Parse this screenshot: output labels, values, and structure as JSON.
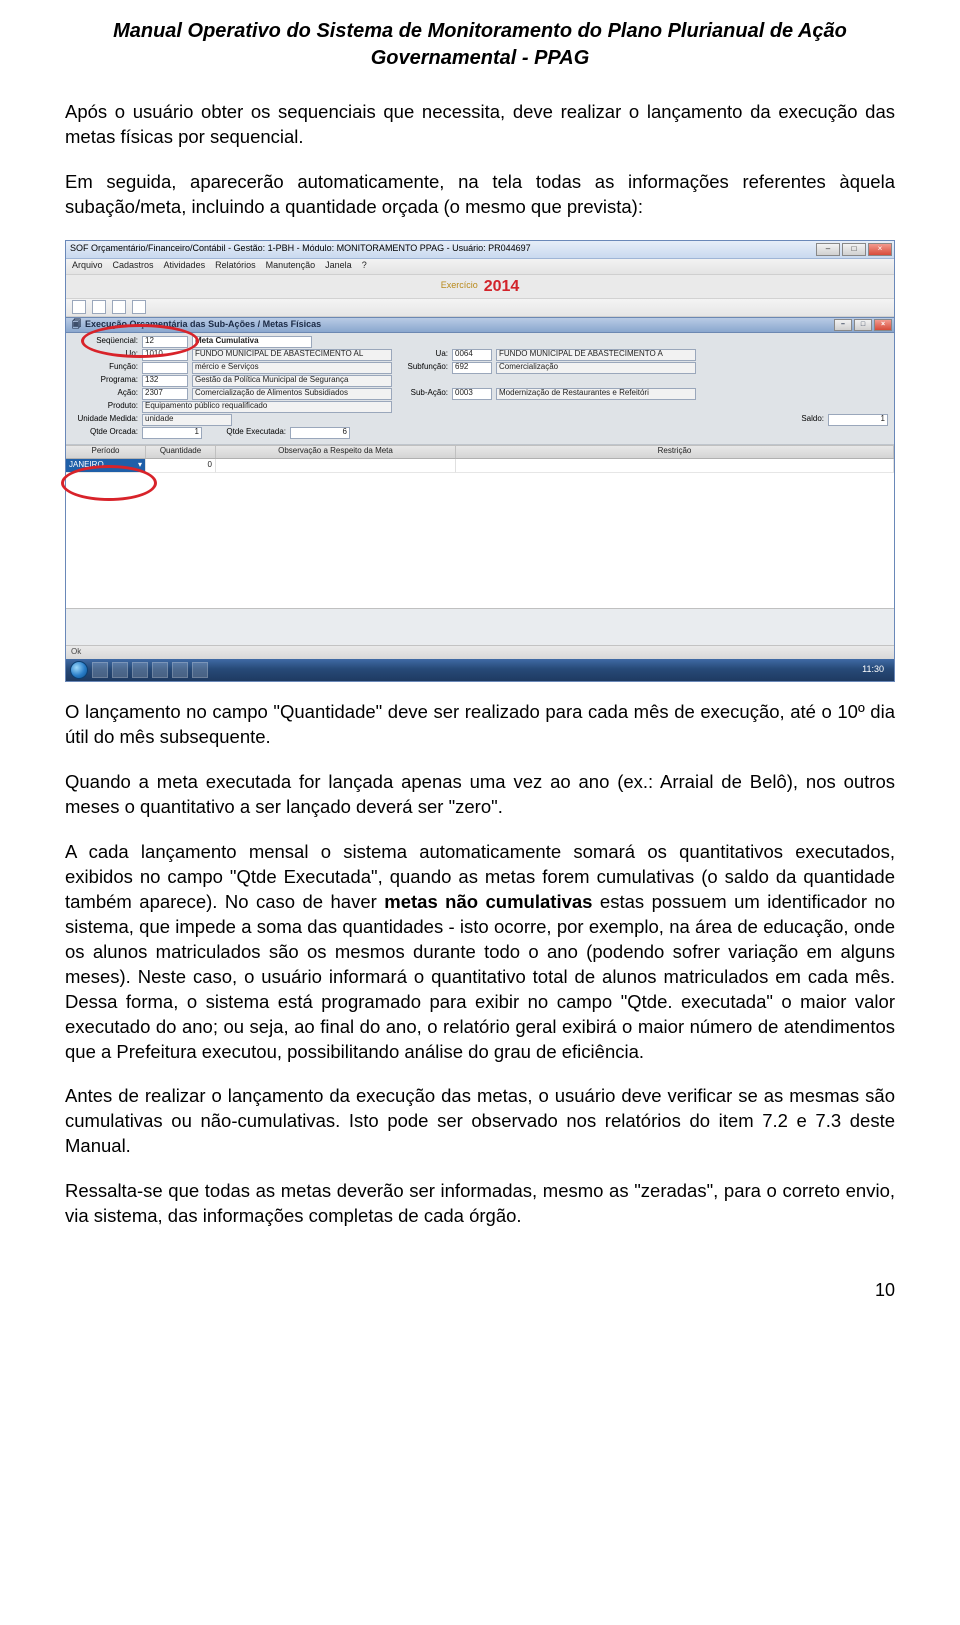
{
  "header": {
    "line1": "Manual Operativo do Sistema de Monitoramento do Plano Plurianual de Ação",
    "line2": "Governamental - PPAG"
  },
  "paragraphs": {
    "p1": "Após o usuário obter os sequenciais que necessita, deve realizar o lançamento da execução das metas físicas por sequencial.",
    "p2": "Em seguida, aparecerão automaticamente, na tela todas as informações referentes àquela subação/meta, incluindo a quantidade orçada (o mesmo que prevista):",
    "p3": "O lançamento no campo \"Quantidade\" deve ser realizado para cada mês de execução, até o 10º dia útil do mês subsequente.",
    "p4": "Quando a meta executada for lançada apenas uma vez ao ano (ex.: Arraial de Belô), nos outros meses o quantitativo a ser lançado deverá ser \"zero\".",
    "p5a": "A cada lançamento mensal o sistema automaticamente somará os quantitativos executados, exibidos no campo \"Qtde Executada\", quando as metas forem cumulativas (o saldo da quantidade também aparece). No caso de haver ",
    "p5b": "metas não cumulativas",
    "p5c": " estas possuem um identificador no sistema, que impede a soma das quantidades - isto ocorre, por exemplo, na área de educação, onde os alunos matriculados são os mesmos durante todo o ano (podendo sofrer variação em alguns meses). Neste caso, o usuário informará o quantitativo total de alunos matriculados em cada mês. Dessa forma, o sistema está programado para exibir no campo \"Qtde. executada\" o maior valor executado do ano; ou seja, ao final do ano, o relatório geral exibirá o maior número de atendimentos que a Prefeitura executou, possibilitando análise do grau de eficiência.",
    "p6": "Antes de realizar o lançamento da execução das metas, o usuário deve verificar se as mesmas são cumulativas ou não-cumulativas. Isto pode ser observado nos relatórios do item 7.2 e 7.3 deste Manual.",
    "p7": "Ressalta-se que todas as metas deverão ser informadas, mesmo as \"zeradas\", para o correto envio, via sistema, das informações completas de cada órgão."
  },
  "screenshot": {
    "title": "SOF Orçamentário/Financeiro/Contábil - Gestão: 1-PBH - Módulo: MONITORAMENTO PPAG - Usuário: PR044697",
    "menu": [
      "Arquivo",
      "Cadastros",
      "Atividades",
      "Relatórios",
      "Manutenção",
      "Janela",
      "?"
    ],
    "exercicio_label": "Exercício",
    "exercicio_year": "2014",
    "section_title": "Execução Orçamentária das Sub-Ações / Metas Físicas",
    "fields": {
      "sequencial_label": "Seqüencial:",
      "sequencial_value": "12",
      "meta_cumulativa": "Meta Cumulativa",
      "uo_label": "Uo:",
      "uo_value": "1010",
      "uo_desc": "FUNDO MUNICIPAL DE ABASTECIMENTO AL",
      "ua_label": "Ua:",
      "ua_value": "0064",
      "ua_desc": "FUNDO MUNICIPAL DE ABASTECIMENTO A",
      "funcao_label": "Função:",
      "funcao_value": "",
      "funcao_desc": "mércio e Serviços",
      "subfuncao_label": "Subfunção:",
      "subfuncao_value": "692",
      "subfuncao_desc": "Comercialização",
      "programa_label": "Programa:",
      "programa_value": "132",
      "programa_desc": "Gestão da Política Municipal de Segurança",
      "acao_label": "Ação:",
      "acao_value": "2307",
      "acao_desc": "Comercialização de Alimentos Subsidiados",
      "subacao_label": "Sub-Ação:",
      "subacao_value": "0003",
      "subacao_desc": "Modernização de Restaurantes e Refeitóri",
      "produto_label": "Produto:",
      "produto_desc": "Equipamento público requalificado",
      "unidade_label": "Unidade Medida:",
      "unidade_desc": "unidade",
      "saldo_label": "Saldo:",
      "saldo_value": "1",
      "qtde_orcada_label": "Qtde Orcada:",
      "qtde_orcada_value": "1",
      "qtde_exec_label": "Qtde Executada:",
      "qtde_exec_value": "6"
    },
    "grid": {
      "headers": [
        "Período",
        "Quantidade",
        "Observação a Respeito da Meta",
        "Restrição"
      ],
      "row1_periodo": "JANEIRO",
      "row1_quantidade": "0"
    },
    "status_ok": "Ok",
    "clock": "11:30"
  },
  "page_number": "10"
}
